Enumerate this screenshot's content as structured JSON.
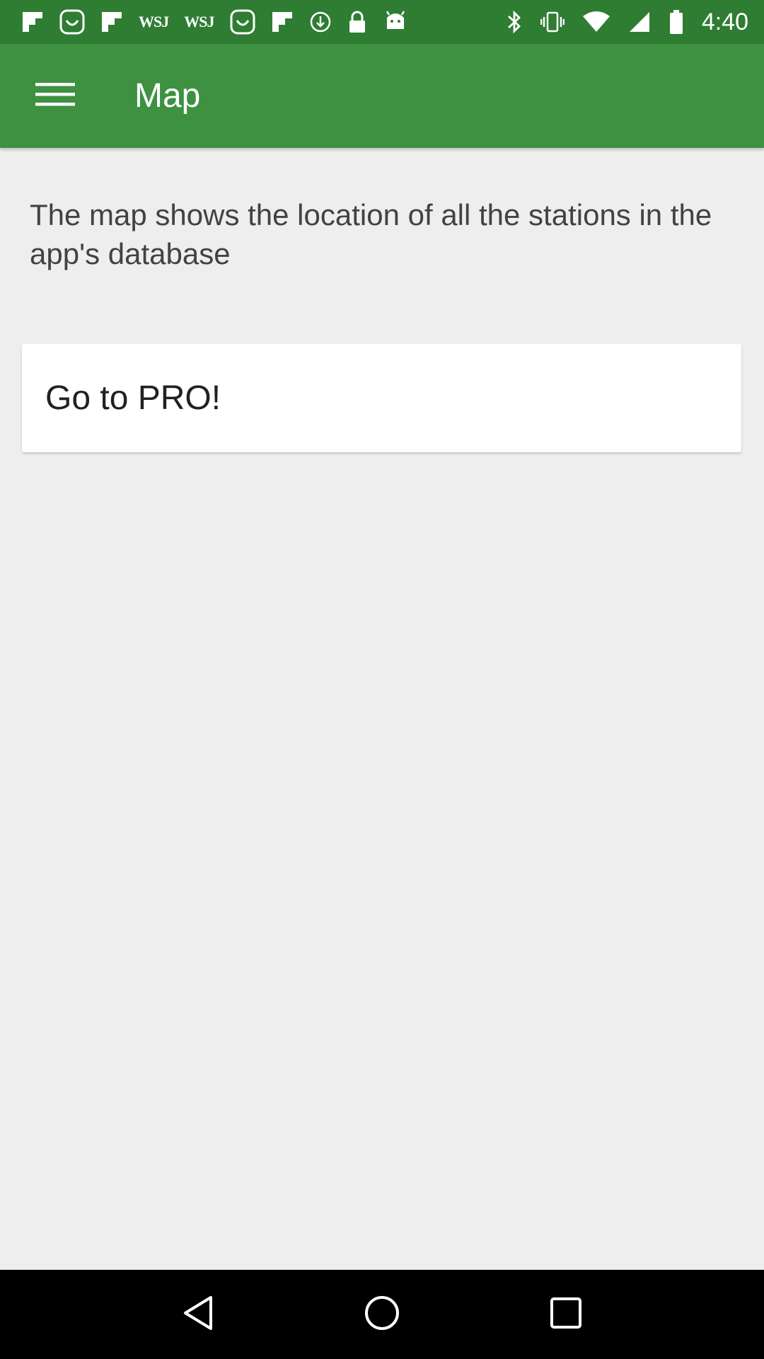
{
  "status_bar": {
    "time": "4:40",
    "left_icons": [
      {
        "name": "flipboard-icon"
      },
      {
        "name": "smiley-icon"
      },
      {
        "name": "flipboard-icon"
      },
      {
        "name": "wsj-icon",
        "text": "WSJ"
      },
      {
        "name": "wsj-icon",
        "text": "WSJ"
      },
      {
        "name": "smiley-icon"
      },
      {
        "name": "flipboard-icon"
      },
      {
        "name": "download-icon"
      },
      {
        "name": "lock-icon"
      },
      {
        "name": "android-icon"
      }
    ],
    "right_icons": [
      {
        "name": "bluetooth-icon"
      },
      {
        "name": "vibrate-icon"
      },
      {
        "name": "wifi-icon"
      },
      {
        "name": "signal-icon"
      },
      {
        "name": "battery-icon"
      }
    ]
  },
  "app_bar": {
    "title": "Map",
    "menu_icon": "hamburger-menu-icon",
    "background_color": "#3d9140"
  },
  "main": {
    "description": "The map shows the location of all the stations in the app's database",
    "pro_button_label": "Go to PRO!"
  },
  "nav_bar": {
    "buttons": [
      {
        "name": "back-icon"
      },
      {
        "name": "home-icon"
      },
      {
        "name": "recents-icon"
      }
    ]
  },
  "colors": {
    "status_bar": "#2e7d32",
    "app_bar": "#3d9140",
    "background": "#eeeeee",
    "card": "#ffffff"
  }
}
